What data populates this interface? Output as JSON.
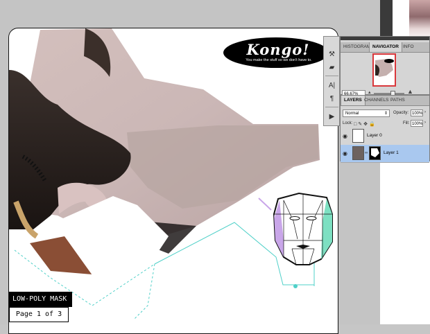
{
  "document": {
    "logo_text": "Kongo!",
    "logo_tagline": "You make the stuff so we don't have to.",
    "title": "LOW-POLY MASK",
    "page_label": "Page 1 of 3"
  },
  "tools_panel": {
    "icons": [
      "history-brush-icon",
      "sample-icon",
      "character-icon",
      "paragraph-icon",
      "actions-icon"
    ]
  },
  "navigator_panel": {
    "tabs": [
      "HISTOGRAM",
      "NAVIGATOR",
      "INFO"
    ],
    "active_tab": "NAVIGATOR",
    "zoom": "66.67%"
  },
  "layers_panel": {
    "tabs": [
      "LAYERS",
      "CHANNELS",
      "PATHS"
    ],
    "active_tab": "LAYERS",
    "blend_mode": "Normal",
    "opacity_label": "Opacity:",
    "opacity_value": "100%",
    "lock_label": "Lock:",
    "fill_label": "Fill:",
    "fill_value": "100%",
    "layers": [
      {
        "name": "Layer 0",
        "visible": true,
        "selected": false
      },
      {
        "name": "Layer 1",
        "visible": true,
        "selected": true
      }
    ]
  },
  "colors": {
    "selection_highlight": "#a9c8ef",
    "navigator_box": "#d9373b",
    "guide_cyan": "#4fd0c8",
    "mask_green": "#7de0c2",
    "mask_purple": "#c9a6e9"
  }
}
